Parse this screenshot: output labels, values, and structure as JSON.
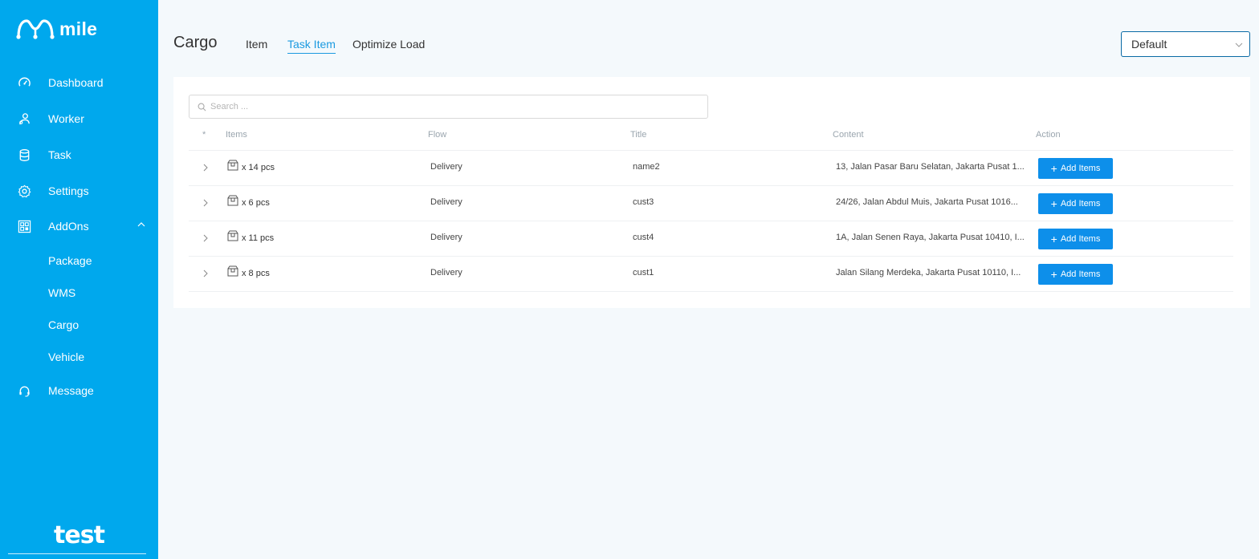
{
  "colors": {
    "sidebar": "#00a8ed",
    "accent": "#1b9ae0",
    "button": "#0d8fea"
  },
  "sidebar": {
    "logo_text": "mile",
    "items": [
      {
        "label": "Dashboard",
        "icon": "speedometer-icon"
      },
      {
        "label": "Worker",
        "icon": "user-icon"
      },
      {
        "label": "Task",
        "icon": "database-icon"
      },
      {
        "label": "Settings",
        "icon": "gear-icon"
      },
      {
        "label": "AddOns",
        "icon": "qr-grid-icon",
        "expanded": true
      },
      {
        "label": "Message",
        "icon": "headset-icon"
      }
    ],
    "addons_children": [
      "Package",
      "WMS",
      "Cargo",
      "Vehicle"
    ],
    "brand": "test"
  },
  "header": {
    "title": "Cargo",
    "tabs": [
      {
        "label": "Item",
        "active": false
      },
      {
        "label": "Task Item",
        "active": true
      },
      {
        "label": "Optimize Load",
        "active": false
      }
    ],
    "select_value": "Default"
  },
  "table": {
    "search_placeholder": "Search ...",
    "columns": [
      "*",
      "Items",
      "Flow",
      "Title",
      "Content",
      "Action"
    ],
    "rows": [
      {
        "qty": "x 14 pcs",
        "flow": "Delivery",
        "title": "name2",
        "content": "13, Jalan Pasar Baru Selatan, Jakarta Pusat 1...",
        "action": "Add Items"
      },
      {
        "qty": "x 6 pcs",
        "flow": "Delivery",
        "title": "cust3",
        "content": "24/26, Jalan Abdul Muis, Jakarta Pusat 1016...",
        "action": "Add Items"
      },
      {
        "qty": "x 11 pcs",
        "flow": "Delivery",
        "title": "cust4",
        "content": "1A, Jalan Senen Raya, Jakarta Pusat 10410, I...",
        "action": "Add Items"
      },
      {
        "qty": "x 8 pcs",
        "flow": "Delivery",
        "title": "cust1",
        "content": "Jalan Silang Merdeka, Jakarta Pusat 10110, I...",
        "action": "Add Items"
      }
    ]
  }
}
